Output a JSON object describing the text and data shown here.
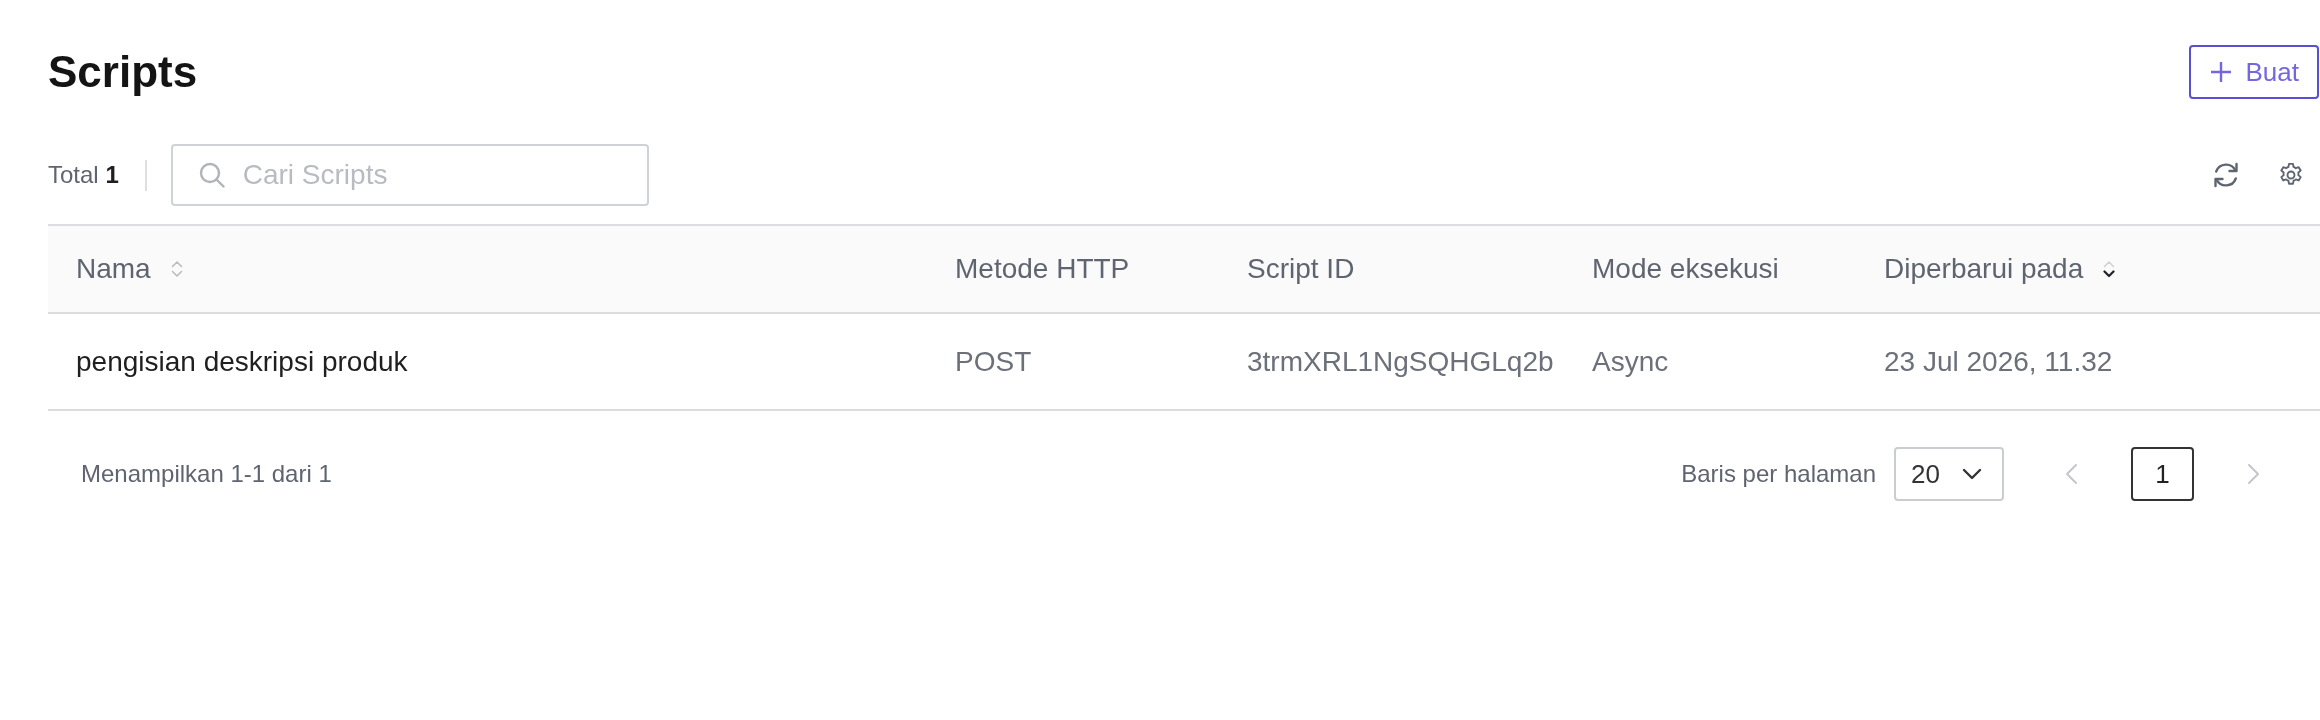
{
  "page": {
    "title": "Scripts",
    "create_button": {
      "label": "Buat"
    }
  },
  "toolbar": {
    "total_label": "Total",
    "total_count": "1",
    "search": {
      "placeholder": "Cari Scripts"
    }
  },
  "table": {
    "columns": [
      {
        "label": "Nama",
        "sortable": true,
        "sorted": false
      },
      {
        "label": "Metode HTTP",
        "sortable": false
      },
      {
        "label": "Script ID",
        "sortable": false
      },
      {
        "label": "Mode eksekusi",
        "sortable": false
      },
      {
        "label": "Diperbarui pada",
        "sortable": true,
        "sorted": true
      }
    ],
    "rows": [
      {
        "cells": [
          "pengisian deskripsi produk",
          "POST",
          "3trmXRL1NgSQHGLq2b",
          "Async",
          "23 Jul 2026, 11.32"
        ]
      }
    ]
  },
  "pagination": {
    "summary": "Menampilkan 1-1 dari 1",
    "rows_per_page_label": "Baris per halaman",
    "rows_per_page": "20",
    "previous": {
      "disabled": true
    },
    "pages": [
      {
        "label": "1",
        "selected": true
      }
    ],
    "next": {
      "disabled": true
    }
  }
}
